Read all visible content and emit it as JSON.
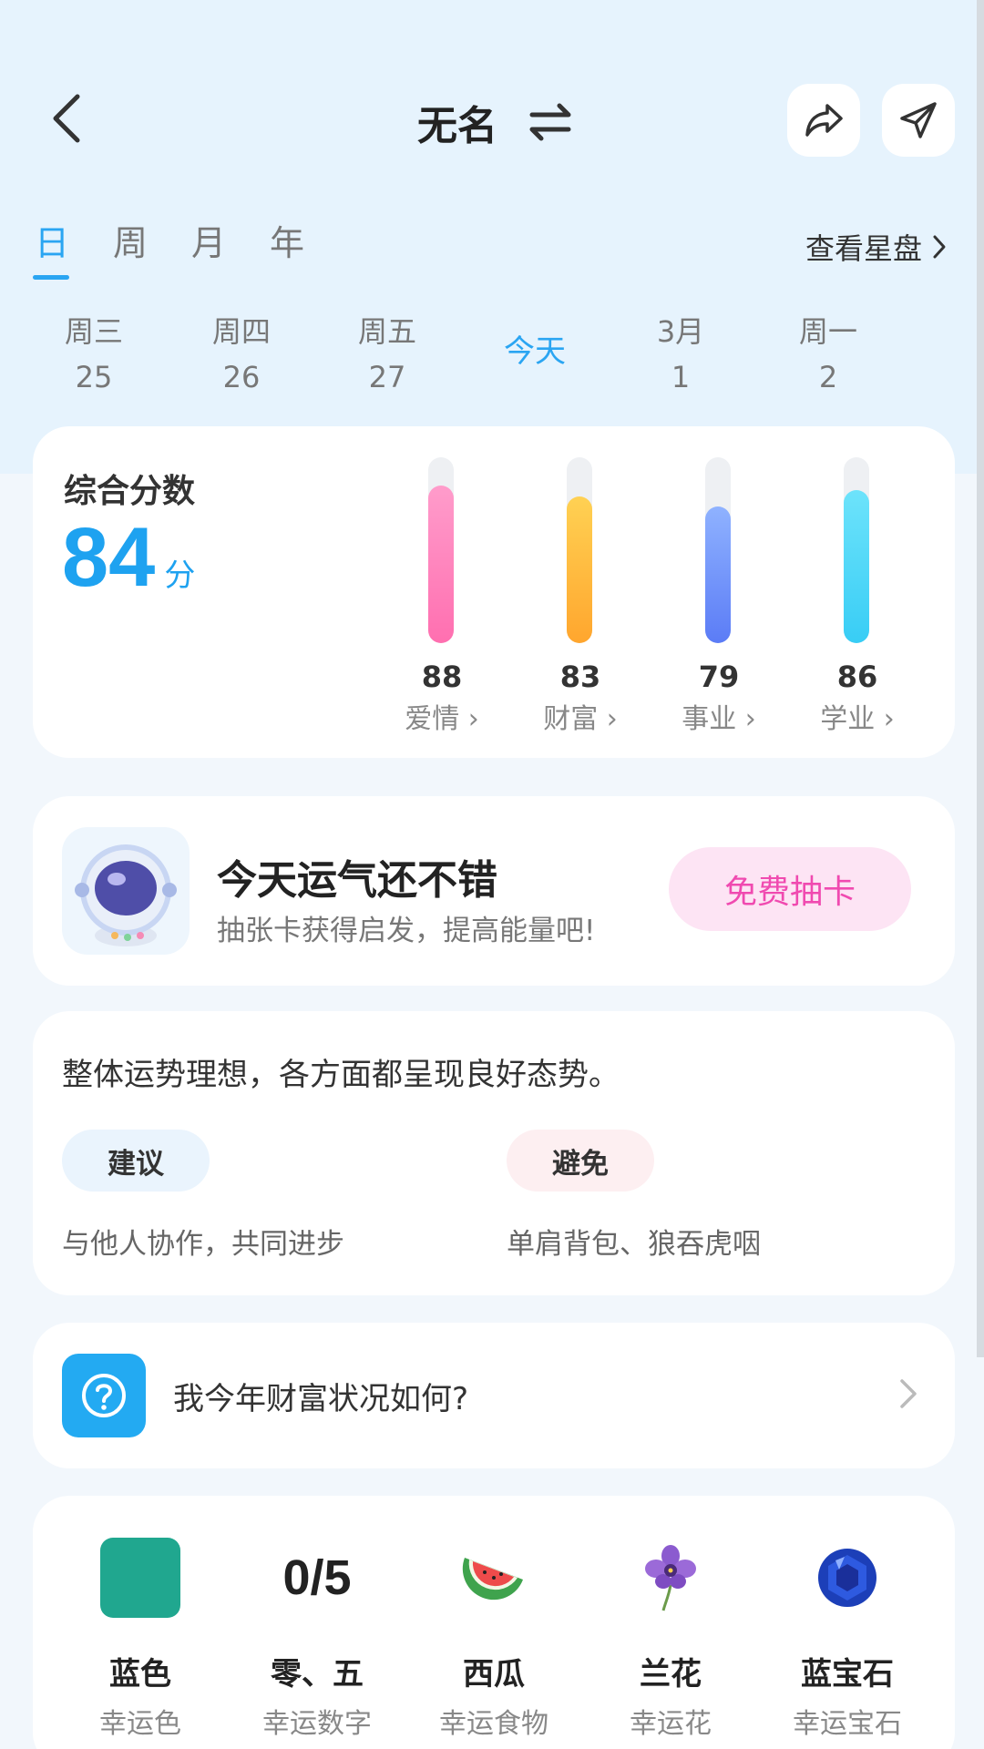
{
  "header": {
    "title": "无名"
  },
  "period_tabs": [
    {
      "label": "日",
      "active": true
    },
    {
      "label": "周",
      "active": false
    },
    {
      "label": "月",
      "active": false
    },
    {
      "label": "年",
      "active": false
    }
  ],
  "view_chart_label": "查看星盘",
  "dates": [
    {
      "weekday": "周三",
      "day": "25"
    },
    {
      "weekday": "周四",
      "day": "26"
    },
    {
      "weekday": "周五",
      "day": "27"
    },
    {
      "weekday": "今天",
      "day": ""
    },
    {
      "weekday": "3月",
      "day": "1"
    },
    {
      "weekday": "周一",
      "day": "2"
    }
  ],
  "score": {
    "label": "综合分数",
    "value": "84",
    "unit": "分",
    "categories": [
      {
        "name": "爱情",
        "value": 88,
        "color_top": "#ff9ccb",
        "color_bottom": "#ff6fb0"
      },
      {
        "name": "财富",
        "value": 83,
        "color_top": "#ffd153",
        "color_bottom": "#ffa62e"
      },
      {
        "name": "事业",
        "value": 79,
        "color_top": "#8fb2ff",
        "color_bottom": "#5b7cf6"
      },
      {
        "name": "学业",
        "value": 86,
        "color_top": "#6de3fb",
        "color_bottom": "#38cdf5"
      }
    ]
  },
  "luck": {
    "title": "今天运气还不错",
    "subtitle": "抽张卡获得启发，提高能量吧!",
    "button": "免费抽卡"
  },
  "fortune": {
    "summary": "整体运势理想，各方面都呈现良好态势。",
    "advise_label": "建议",
    "advise_text": "与他人协作，共同进步",
    "avoid_label": "避免",
    "avoid_text": "单肩背包、狼吞虎咽"
  },
  "question": {
    "text": "我今年财富状况如何?"
  },
  "lucky": {
    "color": {
      "name": "蓝色",
      "label": "幸运色",
      "hex": "#20a78f"
    },
    "number": {
      "display": "0/5",
      "name": "零、五",
      "label": "幸运数字"
    },
    "food": {
      "name": "西瓜",
      "label": "幸运食物",
      "icon": "watermelon-icon"
    },
    "flower": {
      "name": "兰花",
      "label": "幸运花",
      "icon": "orchid-icon"
    },
    "gem": {
      "name": "蓝宝石",
      "label": "幸运宝石",
      "icon": "sapphire-icon"
    }
  },
  "colors": {
    "accent": "#2aa5f2",
    "pink_button": "#f04ab0"
  }
}
